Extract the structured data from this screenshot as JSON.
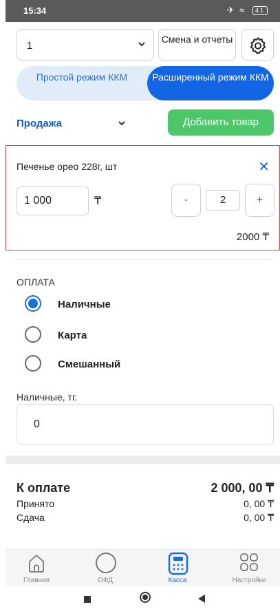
{
  "status_bar": {
    "time": "15:34",
    "icons": "✈ ≈",
    "battery": "41"
  },
  "header": {
    "register_select": {
      "value": "1"
    },
    "shift_button_label": "Смена и отчеты",
    "settings_icon": "gear-icon"
  },
  "mode_toggle": {
    "simple_label": "Простой режим ККМ",
    "advanced_label": "Расширенный режим ККМ",
    "selected": "advanced"
  },
  "operation": {
    "value": "Продажа",
    "add_button_label": "Добавить товар"
  },
  "item": {
    "name": "Печенье орео 228г, шт",
    "price": "1 000",
    "currency": "₸",
    "qty_minus": "-",
    "qty": "2",
    "qty_plus": "+",
    "total": "2000 ₸"
  },
  "payment": {
    "title": "ОПЛАТА",
    "options": [
      {
        "label": "Наличные",
        "checked": true
      },
      {
        "label": "Карта",
        "checked": false
      },
      {
        "label": "Смешанный",
        "checked": false
      }
    ],
    "cash_label": "Наличные, тг.",
    "cash_value": "0"
  },
  "summary": {
    "due_label": "К оплате",
    "due_value": "2 000, 00 ₸",
    "received_label": "Принято",
    "received_value": "0, 00 ₸",
    "change_label": "Сдача",
    "change_value": "0, 00 ₸"
  },
  "bottom_nav": [
    {
      "label": "Главная",
      "icon": "home-icon",
      "active": false
    },
    {
      "label": "ОФД",
      "icon": "circle-icon",
      "active": false
    },
    {
      "label": "Касса",
      "icon": "calculator-icon",
      "active": true
    },
    {
      "label": "Настройки",
      "icon": "grid-icon",
      "active": false
    }
  ],
  "colors": {
    "accent": "#1a6fe0",
    "add_button": "#4cc86a",
    "error_border": "#e23a3a"
  }
}
